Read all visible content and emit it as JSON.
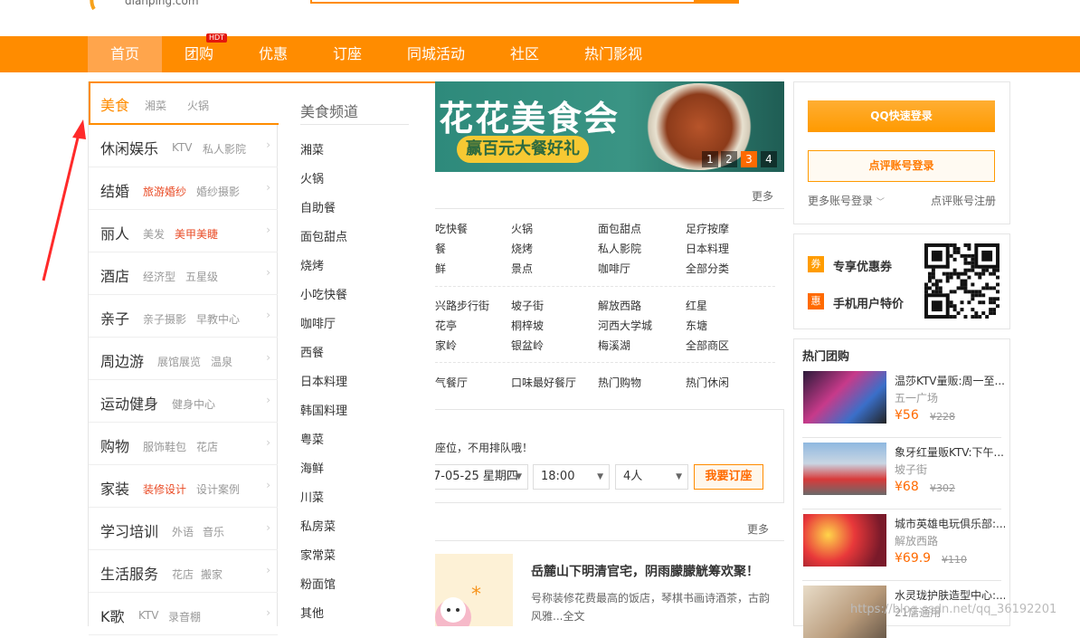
{
  "header": {
    "logo_text": "dianping.com",
    "nav": [
      {
        "label": "首页"
      },
      {
        "label": "团购"
      },
      {
        "label": "优惠"
      },
      {
        "label": "订座"
      },
      {
        "label": "同城活动"
      },
      {
        "label": "社区"
      },
      {
        "label": "热门影视"
      }
    ],
    "hdt_badge": "HDT"
  },
  "categories": [
    {
      "name": "美食",
      "subs": [
        "湘菜",
        "火锅"
      ]
    },
    {
      "name": "休闲娱乐",
      "subs": [
        "KTV",
        "私人影院"
      ]
    },
    {
      "name": "结婚",
      "subs": [
        "旅游婚纱",
        "婚纱摄影"
      ]
    },
    {
      "name": "丽人",
      "subs": [
        "美发",
        "美甲美睫"
      ]
    },
    {
      "name": "酒店",
      "subs": [
        "经济型",
        "五星级"
      ]
    },
    {
      "name": "亲子",
      "subs": [
        "亲子摄影",
        "早教中心"
      ]
    },
    {
      "name": "周边游",
      "subs": [
        "展馆展览",
        "温泉"
      ]
    },
    {
      "name": "运动健身",
      "subs": [
        "健身中心"
      ]
    },
    {
      "name": "购物",
      "subs": [
        "服饰鞋包",
        "花店"
      ]
    },
    {
      "name": "家装",
      "subs": [
        "装修设计",
        "设计案例"
      ]
    },
    {
      "name": "学习培训",
      "subs": [
        "外语",
        "音乐"
      ]
    },
    {
      "name": "生活服务",
      "subs": [
        "花店",
        "搬家"
      ]
    },
    {
      "name": "K歌",
      "subs": [
        "KTV",
        "录音棚"
      ]
    }
  ],
  "submenu": {
    "title": "美食频道",
    "items": [
      "湘菜",
      "火锅",
      "自助餐",
      "面包甜点",
      "烧烤",
      "小吃快餐",
      "咖啡厅",
      "西餐",
      "日本料理",
      "韩国料理",
      "粤菜",
      "海鲜",
      "川菜",
      "私房菜",
      "家常菜",
      "粉面馆",
      "其他"
    ]
  },
  "banner": {
    "title": "花花美食会",
    "subtitle": "赢百元大餐好礼",
    "dots": [
      "1",
      "2",
      "3",
      "4"
    ],
    "active_dot": "3"
  },
  "food_links": {
    "more": "更多",
    "rows": [
      [
        "吃快餐",
        "火锅",
        "面包甜点",
        "足疗按摩"
      ],
      [
        "餐",
        "烧烤",
        "私人影院",
        "日本料理"
      ],
      [
        "鲜",
        "景点",
        "咖啡厅",
        "全部分类"
      ],
      [
        "兴路步行街",
        "坡子街",
        "解放西路",
        "红星"
      ],
      [
        "花亭",
        "桐梓坡",
        "河西大学城",
        "东塘"
      ],
      [
        "家岭",
        "银盆岭",
        "梅溪湖",
        "全部商区"
      ],
      [
        "气餐厅",
        "口味最好餐厅",
        "热门购物",
        "热门休闲"
      ]
    ]
  },
  "booking": {
    "desc": "座位，不用排队哦！",
    "date": "7-05-25 星期四",
    "time": "18:00",
    "people": "4人",
    "button": "我要订座"
  },
  "article": {
    "more": "更多",
    "title": "岳麓山下明清官宅，阴雨朦朦觥筹欢聚！",
    "desc": "号称装修花费最高的饭店，琴棋书画诗酒茶，古韵风雅...全文"
  },
  "login": {
    "qq": "QQ快速登录",
    "dianping": "点评账号登录",
    "more": "更多账号登录",
    "register": "点评账号注册"
  },
  "promos": [
    {
      "icon": "券",
      "label": "专享优惠券",
      "color": "#ff9c00"
    },
    {
      "icon": "惠",
      "label": "手机用户特价",
      "color": "#ff6a00"
    }
  ],
  "deals": {
    "title": "热门团购",
    "items": [
      {
        "name": "温莎KTV量贩:周一至...",
        "area": "五一广场",
        "price": "¥56",
        "old": "¥228"
      },
      {
        "name": "象牙红量贩KTV:下午...",
        "area": "坡子街",
        "price": "¥68",
        "old": "¥302"
      },
      {
        "name": "城市英雄电玩俱乐部:...",
        "area": "解放西路",
        "price": "¥69.9",
        "old": "¥110"
      },
      {
        "name": "水灵珑护肤造型中心:...",
        "area": "21店通用",
        "price": "",
        "old": ""
      }
    ]
  },
  "watermark": "https://blog.csdn.net/qq_36192201"
}
